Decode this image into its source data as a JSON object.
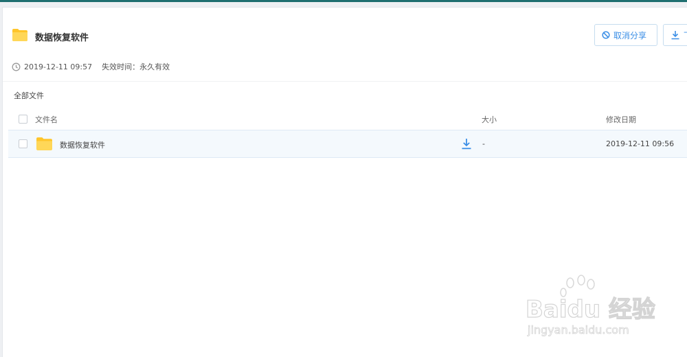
{
  "header": {
    "title": "数据恢复软件",
    "cancel_share_label": "取消分享",
    "download_label": "下载"
  },
  "meta": {
    "share_time": "2019-12-11 09:57",
    "expiry_label": "失效时间：",
    "expiry_value": "永久有效"
  },
  "breadcrumb": "全部文件",
  "table": {
    "columns": [
      "文件名",
      "大小",
      "修改日期"
    ],
    "rows": [
      {
        "name": "数据恢复软件",
        "size": "-",
        "modified": "2019-12-11 09:56"
      }
    ]
  },
  "watermark": {
    "brand": "Baidu 经验",
    "url": "jingyan.baidu.com"
  },
  "colors": {
    "accent": "#3a8ee6",
    "folder": "#ffd04b",
    "row_highlight": "#f4f9fd",
    "top_bar": "#1f6f70"
  }
}
